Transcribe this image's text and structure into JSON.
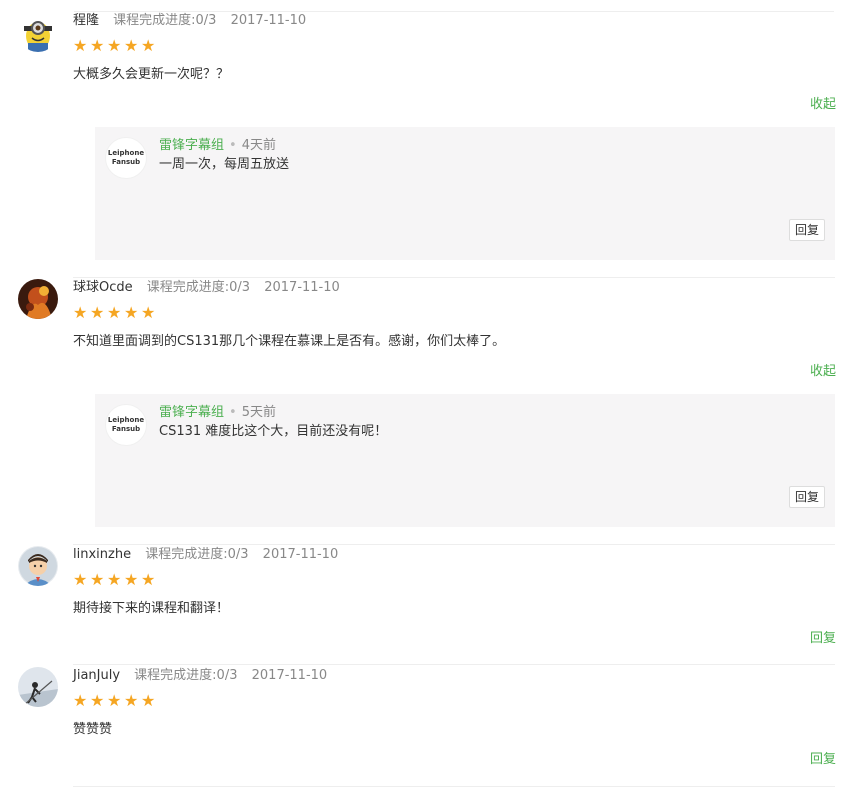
{
  "comments": [
    {
      "user": "程隆",
      "progress": "课程完成进度:0/3",
      "date": "2017-11-10",
      "stars": [
        "★",
        "★",
        "★",
        "★",
        "★"
      ],
      "text": "大概多久会更新一次呢？？",
      "action": "收起",
      "reply": {
        "avatar_line1": "Leiphone",
        "avatar_line2": "Fansub",
        "name": "雷锋字幕组",
        "dot": "•",
        "time": "4天前",
        "text": "一周一次，每周五放送",
        "button": "回复"
      }
    },
    {
      "user": "球球Ocde",
      "progress": "课程完成进度:0/3",
      "date": "2017-11-10",
      "stars": [
        "★",
        "★",
        "★",
        "★",
        "★"
      ],
      "text": "不知道里面调到的CS131那几个课程在慕课上是否有。感谢，你们太棒了。",
      "action": "收起",
      "reply": {
        "avatar_line1": "Leiphone",
        "avatar_line2": "Fansub",
        "name": "雷锋字幕组",
        "dot": "•",
        "time": "5天前",
        "text": "CS131 难度比这个大，目前还没有呢！",
        "button": "回复"
      }
    },
    {
      "user": "linxinzhe",
      "progress": "课程完成进度:0/3",
      "date": "2017-11-10",
      "stars": [
        "★",
        "★",
        "★",
        "★",
        "★"
      ],
      "text": "期待接下来的课程和翻译！",
      "action": "回复"
    },
    {
      "user": "JianJuly",
      "progress": "课程完成进度:0/3",
      "date": "2017-11-10",
      "stars": [
        "★",
        "★",
        "★",
        "★",
        "★"
      ],
      "text": "赞赞赞",
      "action": "回复"
    }
  ],
  "colors": {
    "accent_green": "#4caf50",
    "star_orange": "#f5a623",
    "reply_bg": "#f6f5f6"
  }
}
